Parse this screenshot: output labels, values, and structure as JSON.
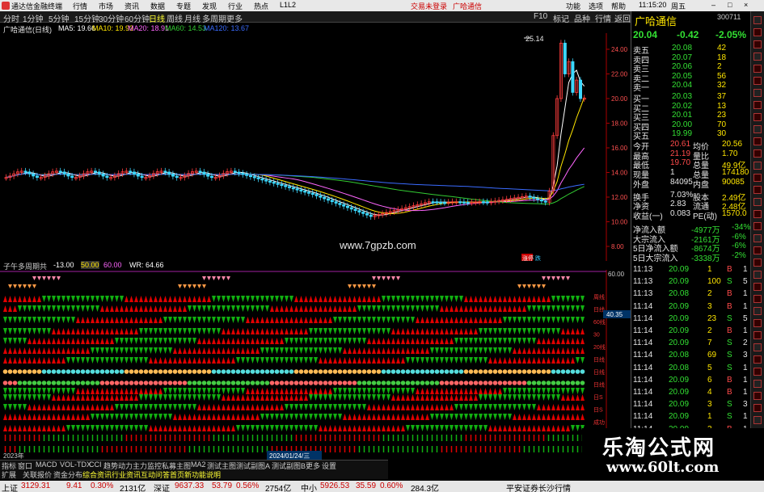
{
  "window": {
    "title": "通达信金融终端",
    "menus": [
      "行情",
      "市场",
      "资讯",
      "数据",
      "专题",
      "发现",
      "行业",
      "热点",
      "L1L2"
    ],
    "trade_links": [
      "交易未登录",
      "广哈通信"
    ],
    "right_menus": [
      "功能",
      "选项",
      "帮助"
    ],
    "clock": "11:15:20",
    "win_buttons": [
      "周五"
    ]
  },
  "periodbar": {
    "items": [
      "分时",
      "1分钟",
      "5分钟",
      "15分钟",
      "30分钟",
      "60分钟",
      "日线",
      "周线",
      "月线",
      "多周期",
      "更多"
    ],
    "active": "日线",
    "right_items": [
      "F10",
      "标记",
      "品种",
      "行情",
      "返回"
    ]
  },
  "ma_bar": {
    "label": "广哈通信(日线)",
    "ma5": "MA5: 19.66",
    "ma10": "MA10: 19.93",
    "ma20": "MA20: 18.91",
    "ma60": "MA60: 14.53",
    "ma120": "MA120: 13.67",
    "colors": {
      "ma5": "#ffffff",
      "ma10": "#ffe600",
      "ma20": "#ff66ff",
      "ma60": "#33cc33",
      "ma120": "#3a6bff"
    }
  },
  "price_chart": {
    "high_label": "25.14",
    "y_ticks": [
      "24.00",
      "22.00",
      "20.00",
      "18.00",
      "16.00",
      "14.00",
      "12.00",
      "10.00",
      "8.00"
    ],
    "watermark": "www.7gpzb.com",
    "bottom_tags": [
      "涨停",
      "跌"
    ]
  },
  "indicator": {
    "name": "子午多周期共",
    "values": [
      "-13.00",
      "50.00",
      "60.00"
    ],
    "wr": "WR: 64.66",
    "y_ticks": [
      "60.00",
      "40.00",
      "20.00",
      "0.00"
    ],
    "cross_label": "40.35",
    "row_labels": [
      "周线",
      "日线",
      "60线",
      "30",
      "20线",
      "日线",
      "日线",
      "日线",
      "日S",
      "日S",
      "成功"
    ],
    "dates": [
      "2023年",
      "2024/01/24/三"
    ]
  },
  "tabs_row1": [
    "指标",
    "窗口",
    "MACD",
    "VOL-TDX",
    "CCI",
    "趋势动力",
    "主力监控",
    "私募主图",
    "MA2",
    "测试主图",
    "测试副图A",
    "测试副图B",
    "更多",
    "设置"
  ],
  "tabs_row2": [
    "扩展",
    "关联报价",
    "资金分布",
    "综合资讯",
    "行业资讯",
    "互动问答",
    "首页新功能说明"
  ],
  "quote": {
    "name": "广哈通信",
    "code": "300711",
    "price": "20.04",
    "change": "-0.42",
    "pct": "-2.05%",
    "asks": [
      {
        "label": "卖五",
        "price": "20.08",
        "vol": "42"
      },
      {
        "label": "卖四",
        "price": "20.07",
        "vol": "18"
      },
      {
        "label": "卖三",
        "price": "20.06",
        "vol": "2"
      },
      {
        "label": "卖二",
        "price": "20.05",
        "vol": "56"
      },
      {
        "label": "卖一",
        "price": "20.04",
        "vol": "32"
      }
    ],
    "bids": [
      {
        "label": "买一",
        "price": "20.03",
        "vol": "37"
      },
      {
        "label": "买二",
        "price": "20.02",
        "vol": "13"
      },
      {
        "label": "买三",
        "price": "20.01",
        "vol": "23"
      },
      {
        "label": "买四",
        "price": "20.00",
        "vol": "70"
      },
      {
        "label": "买五",
        "price": "19.99",
        "vol": "30"
      }
    ],
    "stats": [
      {
        "l1": "今开",
        "v1": "20.61",
        "l2": "均价",
        "v2": "20.56"
      },
      {
        "l1": "最高",
        "v1": "21.19",
        "l2": "量比",
        "v2": "1.70"
      },
      {
        "l1": "最低",
        "v1": "19.70",
        "l2": "总量",
        "v2": "49.9亿"
      },
      {
        "l1": "现量",
        "v1": "1",
        "l2": "总量",
        "v2": "174180"
      },
      {
        "l1": "外盘",
        "v1": "84095",
        "l2": "内盘",
        "v2": "90085"
      },
      {
        "l1": "换手",
        "v1": "7.03%",
        "l2": "股本",
        "v2": "2.49亿"
      },
      {
        "l1": "净资",
        "v1": "2.83",
        "l2": "流通",
        "v2": "2.48亿"
      },
      {
        "l1": "收益(一)",
        "v1": "0.083",
        "l2": "PE(动)",
        "v2": "1570.0"
      }
    ],
    "flows": [
      {
        "label": "净流入额",
        "value": "-4977万",
        "pct": "-34%"
      },
      {
        "label": "大宗流入",
        "value": "-2161万",
        "pct": "-6%"
      },
      {
        "label": "5日净流入额",
        "value": "-8674万",
        "pct": "-6%"
      },
      {
        "label": "5日大宗流入",
        "value": "-3338万",
        "pct": "-2%"
      }
    ],
    "ticks": [
      {
        "t": "11:13",
        "p": "20.09",
        "v": "1",
        "d": "B",
        "n": "1"
      },
      {
        "t": "11:13",
        "p": "20.09",
        "v": "100",
        "d": "S",
        "n": "5"
      },
      {
        "t": "11:13",
        "p": "20.08",
        "v": "2",
        "d": "B",
        "n": "1"
      },
      {
        "t": "11:14",
        "p": "20.09",
        "v": "3",
        "d": "B",
        "n": "1"
      },
      {
        "t": "11:14",
        "p": "20.09",
        "v": "23",
        "d": "S",
        "n": "5"
      },
      {
        "t": "11:14",
        "p": "20.09",
        "v": "2",
        "d": "B",
        "n": "1"
      },
      {
        "t": "11:14",
        "p": "20.09",
        "v": "7",
        "d": "S",
        "n": "2"
      },
      {
        "t": "11:14",
        "p": "20.08",
        "v": "69",
        "d": "S",
        "n": "3"
      },
      {
        "t": "11:14",
        "p": "20.08",
        "v": "5",
        "d": "S",
        "n": "1"
      },
      {
        "t": "11:14",
        "p": "20.09",
        "v": "6",
        "d": "B",
        "n": "1"
      },
      {
        "t": "11:14",
        "p": "20.09",
        "v": "4",
        "d": "B",
        "n": "1"
      },
      {
        "t": "11:14",
        "p": "20.09",
        "v": "3",
        "d": "S",
        "n": "3"
      },
      {
        "t": "11:14",
        "p": "20.09",
        "v": "1",
        "d": "S",
        "n": "1"
      },
      {
        "t": "11:14",
        "p": "20.09",
        "v": "3",
        "d": "B",
        "n": "1"
      }
    ]
  },
  "status": {
    "sh_label": "上证",
    "sh_val": "3129.31",
    "sh_chg": "9.41",
    "sh_pct": "0.30%",
    "sh_amt": "2131亿",
    "sz_label": "深证",
    "sz_val": "9637.33",
    "sz_chg": "53.79",
    "sz_pct": "0.56%",
    "sz_amt": "2754亿",
    "zx_label": "中小",
    "zx_val": "5926.53",
    "zx_chg": "35.59",
    "zx_pct": "0.60%",
    "zx_amt": "284.3亿",
    "broker": "平安证券长沙行情"
  },
  "watermark_site": {
    "line1": "乐淘公式网",
    "line2": "www.60lt.com"
  }
}
